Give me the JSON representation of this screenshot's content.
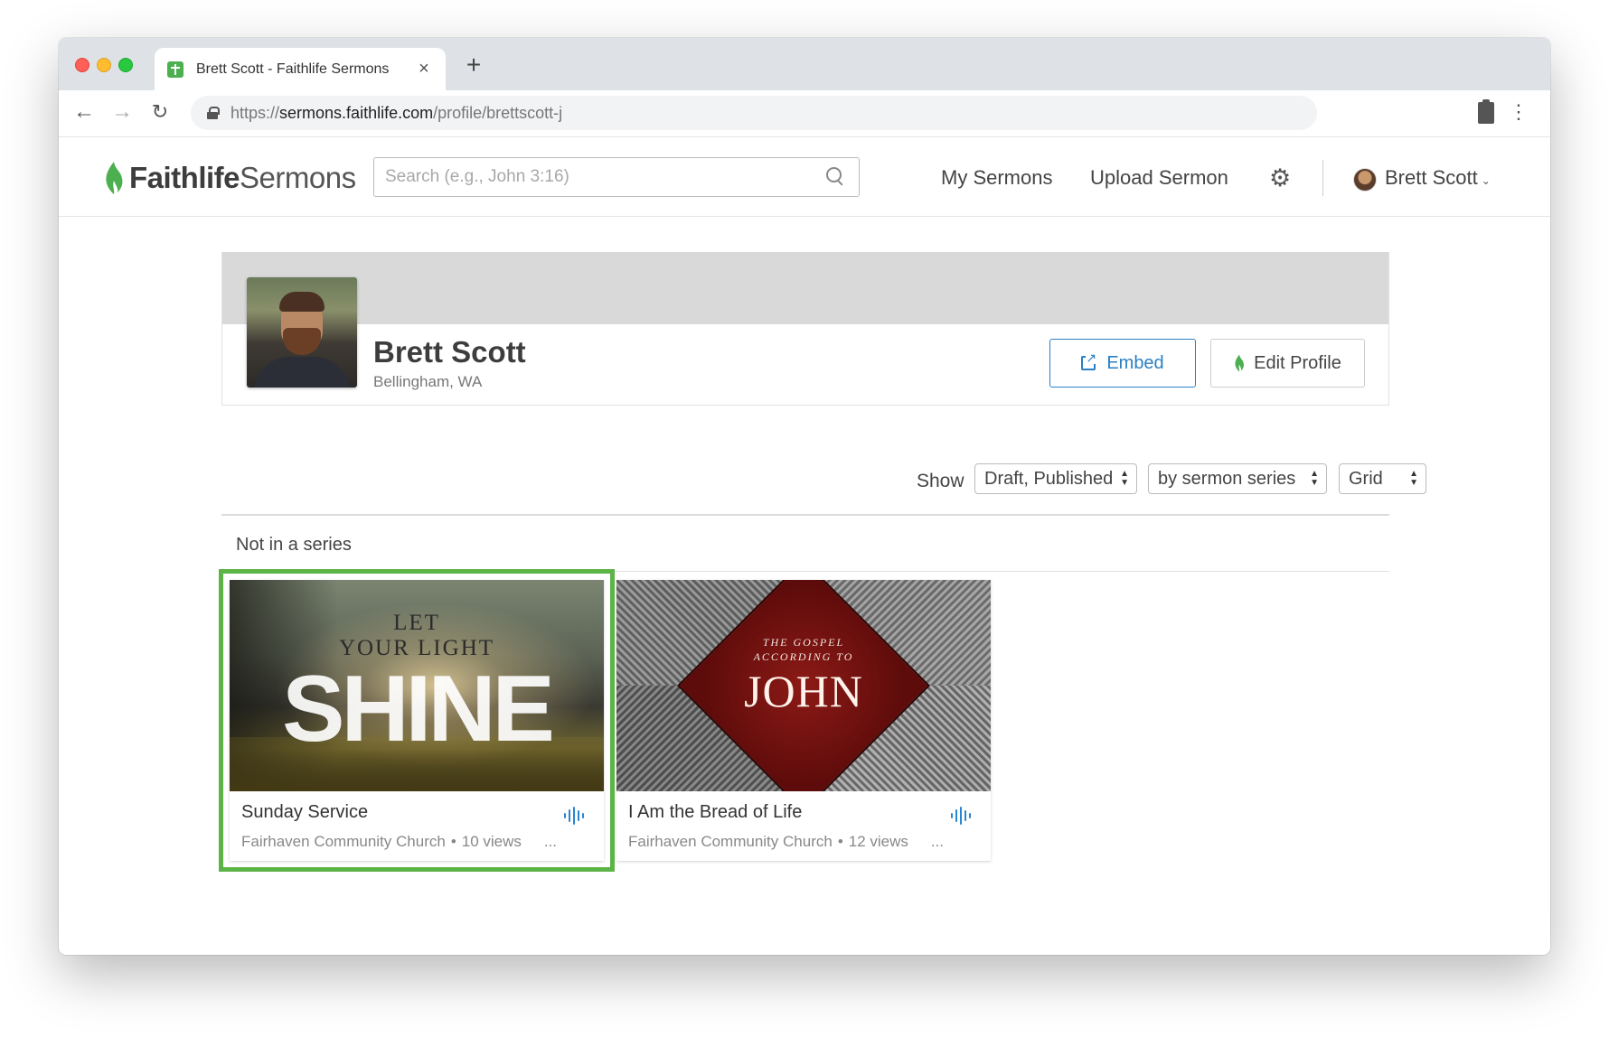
{
  "browser": {
    "tab_title": "Brett Scott - Faithlife Sermons",
    "tab_close": "×",
    "new_tab": "+",
    "url_scheme": "https://",
    "url_host": "sermons.faithlife.com",
    "url_path": "/profile/brettscott-j",
    "back": "←",
    "forward": "→",
    "reload": "↻",
    "menu": "⋮"
  },
  "header": {
    "logo_bold": "Faithlife",
    "logo_light": "Sermons",
    "search_placeholder": "Search (e.g., John 3:16)",
    "my_sermons": "My Sermons",
    "upload_sermon": "Upload Sermon",
    "gear": "⚙",
    "user_name": "Brett Scott",
    "user_caret": "⌄"
  },
  "profile": {
    "name": "Brett Scott",
    "location": "Bellingham, WA",
    "embed_label": "Embed",
    "edit_label": "Edit Profile"
  },
  "filters": {
    "show_label": "Show",
    "status": "Draft, Published",
    "grouping": "by sermon series",
    "view": "Grid"
  },
  "section": {
    "title": "Not in a series"
  },
  "sermons": [
    {
      "title": "Sunday Service",
      "church": "Fairhaven Community Church",
      "views": "10 views",
      "more": "...",
      "art_line1": "LET",
      "art_line2": "YOUR LIGHT",
      "art_big": "SHINE"
    },
    {
      "title": "I Am the Bread of Life",
      "church": "Fairhaven Community Church",
      "views": "12 views",
      "more": "...",
      "art_line1": "THE GOSPEL",
      "art_line2": "ACCORDING TO",
      "art_big": "JOHN"
    }
  ],
  "colors": {
    "accent_blue": "#2a7fc4",
    "highlight_green": "#5cb446",
    "logo_green": "#4caf50"
  }
}
